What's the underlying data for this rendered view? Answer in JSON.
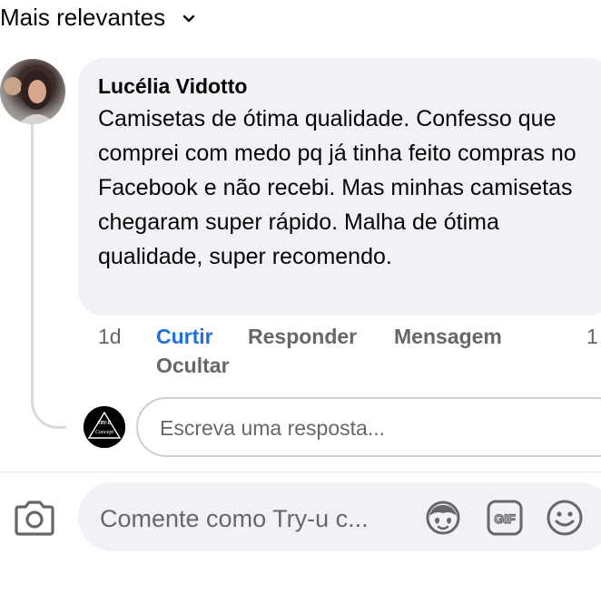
{
  "sort": {
    "label": "Mais relevantes"
  },
  "comment": {
    "author": "Lucélia Vidotto",
    "text": "Camisetas de ótima qualidade. Confesso que comprei com medo pq já tinha feito compras no Facebook e não recebi. Mas minhas camisetas chegaram super rápido. Malha de ótima qualidade, super recomendo.",
    "time": "1d",
    "like_label": "Curtir",
    "reply_label": "Responder",
    "message_label": "Mensagem",
    "reaction_count": "1",
    "hide_label": "Ocultar"
  },
  "reply": {
    "placeholder": "Escreva uma resposta..."
  },
  "composer": {
    "placeholder": "Comente como Try-u c..."
  },
  "page_logo": {
    "text": "TRY-U Concept"
  },
  "colors": {
    "accent": "#216fdb",
    "bubble": "#f0f2f5",
    "muted": "#65676b"
  },
  "icons": [
    "chevron-down-icon",
    "camera-icon",
    "avatar-sticker-icon",
    "gif-icon",
    "emoji-icon"
  ]
}
